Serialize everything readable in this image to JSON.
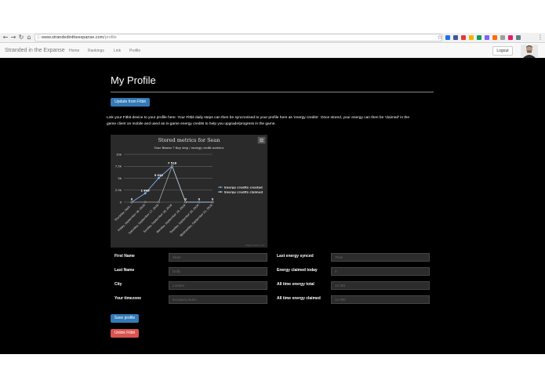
{
  "browser": {
    "url_host": "www.strandedintheexpanse.com",
    "url_path": "/profile",
    "ext_colors": [
      "#1a73e8",
      "#3b5998",
      "#e53935",
      "#f4b400",
      "#0f9d58",
      "#7b61ff",
      "#ff6d00",
      "#9e9e9e",
      "#e91e63",
      "#607d8b"
    ]
  },
  "nav": {
    "brand": "Stranded in the Expanse",
    "links": [
      "Home",
      "Rankings",
      "Link",
      "Profile"
    ],
    "logout": "Logout"
  },
  "page": {
    "title": "My Profile",
    "update_button": "Update from Fitbit",
    "intro_line1": "Link your Fitbit device to your profile here. Your Fitbit daily steps can then be syncronised to your profile here as 'energy credits'. Once stored, your energy can then be 'claimed' in the",
    "intro_line2": "game client on mobile and used as in-game energy credits to help you upgrade/progress in the game.",
    "save_button": "Save profile",
    "unlink_button": "Unlink Fitbit"
  },
  "chart_data": {
    "type": "line",
    "title": "Stored metrics for Sean",
    "subtitle": "Your fitness 7-day step / energy credit metrics",
    "credit": "Highcharts.com",
    "categories": [
      "Thursday, Sept...",
      "Friday, September 16, 2016",
      "Saturday, September 17, 2016",
      "Sunday, September 18, 2016",
      "Monday, September 19, 2016",
      "Tuesday, September 20, 2016",
      "Wednesday, September 21, 2016"
    ],
    "yticks": [
      "10k",
      "7.5k",
      "5k",
      "2.5k",
      "0"
    ],
    "ylim": [
      0,
      10000
    ],
    "series": [
      {
        "name": "Energy credits created",
        "values": [
          0,
          1843,
          5032,
          7516,
          0,
          0,
          0
        ],
        "labels": [
          "0",
          "1 843",
          "5 032",
          "7 516",
          "0",
          "0",
          "0"
        ],
        "color": "#7cb5ec"
      },
      {
        "name": "Energy credits claimed",
        "values": [
          0,
          0,
          0,
          7516,
          0,
          0,
          0
        ],
        "labels": [],
        "color": "#cccccc"
      }
    ]
  },
  "form": {
    "left": [
      {
        "label": "First Name",
        "value": "Sean"
      },
      {
        "label": "Last Name",
        "value": "Duffy"
      },
      {
        "label": "City",
        "value": "London"
      },
      {
        "label": "Your timezone",
        "value": "Europe/London"
      }
    ],
    "right": [
      {
        "label": "Last energy synced",
        "value": "7516"
      },
      {
        "label": "Energy claimed today",
        "value": "0"
      },
      {
        "label": "All time energy total",
        "value": "14 391"
      },
      {
        "label": "All time energy claimed",
        "value": "12 000"
      }
    ]
  }
}
